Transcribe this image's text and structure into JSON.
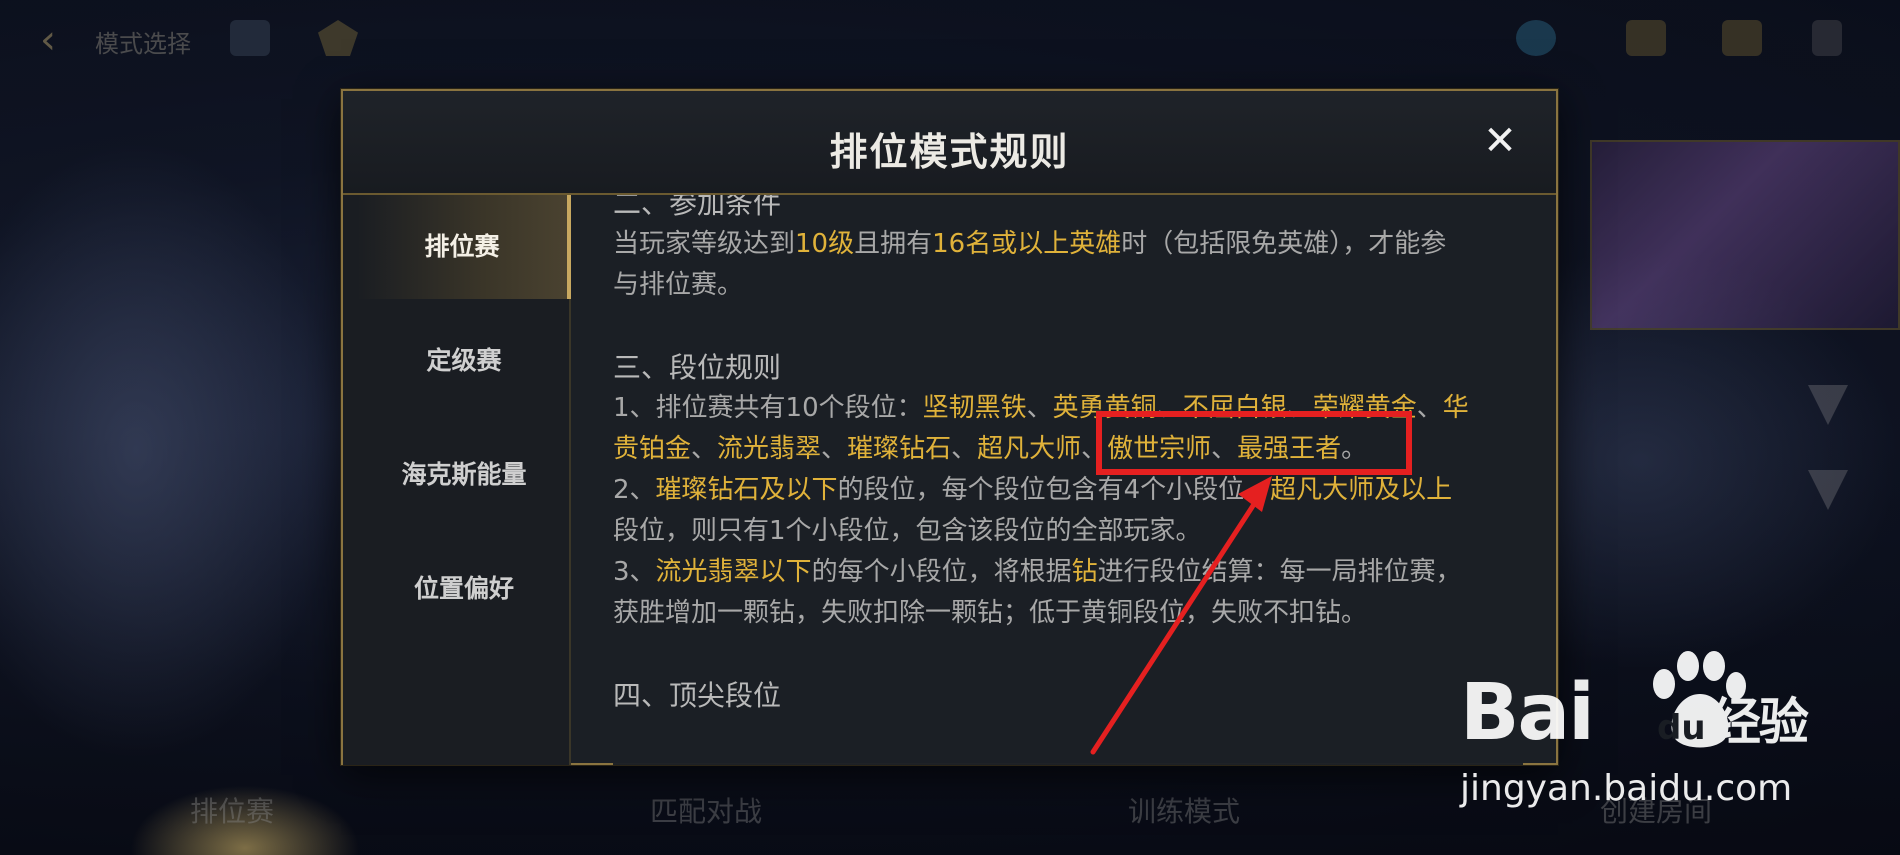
{
  "topbar": {
    "mode_title": "模式选择",
    "faded_label": ""
  },
  "modal": {
    "title": "排位模式规则",
    "close_glyph": "✕",
    "tabs": [
      {
        "label": "排位赛",
        "active": true
      },
      {
        "label": "定级赛",
        "active": false
      },
      {
        "label": "海克斯能量",
        "active": false
      },
      {
        "label": "位置偏好",
        "active": false
      }
    ],
    "content": {
      "sec2_heading": "二、参加条件",
      "sec2_p1_a": "当玩家等级达到",
      "sec2_p1_hl1": "10级",
      "sec2_p1_b": "且拥有",
      "sec2_p1_hl2": "16名或以上英雄",
      "sec2_p1_c": "时（包括限免英雄），才能参",
      "sec2_p1_d": "与排位赛。",
      "sec3_heading": "三、段位规则",
      "r1_a": "1、排位赛共有10个段位：",
      "r1_t1": "坚韧黑铁",
      "r1_t2": "英勇黄铜",
      "r1_t3": "不屈白银",
      "r1_t4": "荣耀黄金",
      "r1_t5a": "华",
      "r1_t5b": "贵铂金",
      "r1_t6": "流光翡翠",
      "r1_t7": "璀璨钻石",
      "r1_t8": "超凡大师",
      "r1_t9": "傲世宗师",
      "r1_t10": "最强王者",
      "sep": "、",
      "end": "。",
      "r2_a": "2、",
      "r2_hl1": "璀璨钻石及以下",
      "r2_b": "的段位，每个段位包含有4个小段位。",
      "r2_hl2": "超凡大师及以上",
      "r2_c": "段位，则只有1个小段位，包含该段位的全部玩家。",
      "r3_a": "3、",
      "r3_hl1": "流光翡翠以下",
      "r3_b": "的每个小段位，将根据",
      "r3_hl2": "钻",
      "r3_c": "进行段位结算：每一局排位赛，",
      "r3_d": "获胜增加一颗钻，失败扣除一颗钻；低于黄铜段位，失败不扣钻。",
      "sec4_heading": "四、顶尖段位"
    }
  },
  "bottom_nav": [
    "排位赛",
    "匹配对战",
    "训练模式",
    "创建房间"
  ],
  "watermark": {
    "logo_left": "Bai",
    "logo_du": "du",
    "logo_cn": "经验",
    "url": "jingyan.baidu.com"
  },
  "colors": {
    "accent_gold": "#e0b23a",
    "border_gold": "#8a7440",
    "annotation_red": "#e52020"
  }
}
